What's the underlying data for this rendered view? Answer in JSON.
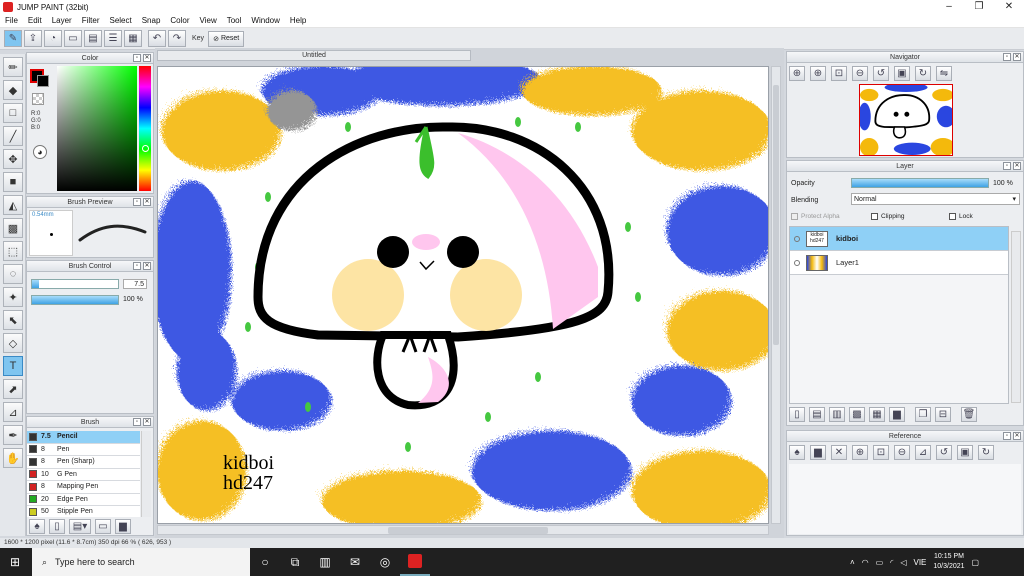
{
  "window": {
    "title": "JUMP PAINT (32bit)",
    "min": "–",
    "max": "❐",
    "close": "✕"
  },
  "menu": [
    "File",
    "Edit",
    "Layer",
    "Filter",
    "Select",
    "Snap",
    "Color",
    "View",
    "Tool",
    "Window",
    "Help"
  ],
  "toolbar": {
    "key_label": "Key",
    "reset_label": "Reset"
  },
  "document": {
    "tab_title": "Untitled"
  },
  "color_panel": {
    "title": "Color",
    "r": "R:0",
    "g": "G:0",
    "b": "B:0",
    "fg_color": "#000000",
    "bg_color": "#e00000"
  },
  "brush_preview": {
    "title": "Brush Preview",
    "size": "0.54mm"
  },
  "brush_control": {
    "title": "Brush Control",
    "size_value": "7.5",
    "opacity_value": "100 %",
    "size_fill": 0.08,
    "opacity_fill": 1.0
  },
  "brush_panel": {
    "title": "Brush",
    "items": [
      {
        "size": "7.5",
        "name": "Pencil",
        "color": "#333333"
      },
      {
        "size": "8",
        "name": "Pen",
        "color": "#333333"
      },
      {
        "size": "8",
        "name": "Pen (Sharp)",
        "color": "#333333"
      },
      {
        "size": "10",
        "name": "G Pen",
        "color": "#d22222"
      },
      {
        "size": "8",
        "name": "Mapping Pen",
        "color": "#d22222"
      },
      {
        "size": "20",
        "name": "Edge Pen",
        "color": "#22aa22"
      },
      {
        "size": "50",
        "name": "Stipple Pen",
        "color": "#cccc22"
      }
    ]
  },
  "navigator": {
    "title": "Navigator"
  },
  "layer_panel": {
    "title": "Layer",
    "opacity_label": "Opacity",
    "opacity_value": "100 %",
    "opacity_fill": 1.0,
    "blending_label": "Blending",
    "blending_value": "Normal",
    "protect_alpha": "Protect Alpha",
    "clipping": "Clipping",
    "lock": "Lock",
    "layers": [
      {
        "name": "kidboi",
        "thumb_text": "kidboi hd247",
        "selected": true
      },
      {
        "name": "Layer1",
        "thumb_text": "",
        "selected": false
      }
    ]
  },
  "reference": {
    "title": "Reference"
  },
  "canvas": {
    "signature_line1": "kidboi",
    "signature_line2": "hd247"
  },
  "status": {
    "text": "1600 * 1200 pixel  (11.6 * 8.7cm)  350 dpi  66 %  ( 626, 953 )"
  },
  "taskbar": {
    "search_placeholder": "Type here to search",
    "lang": "VIE",
    "time": "10:15 PM",
    "date": "10/3/2021"
  }
}
